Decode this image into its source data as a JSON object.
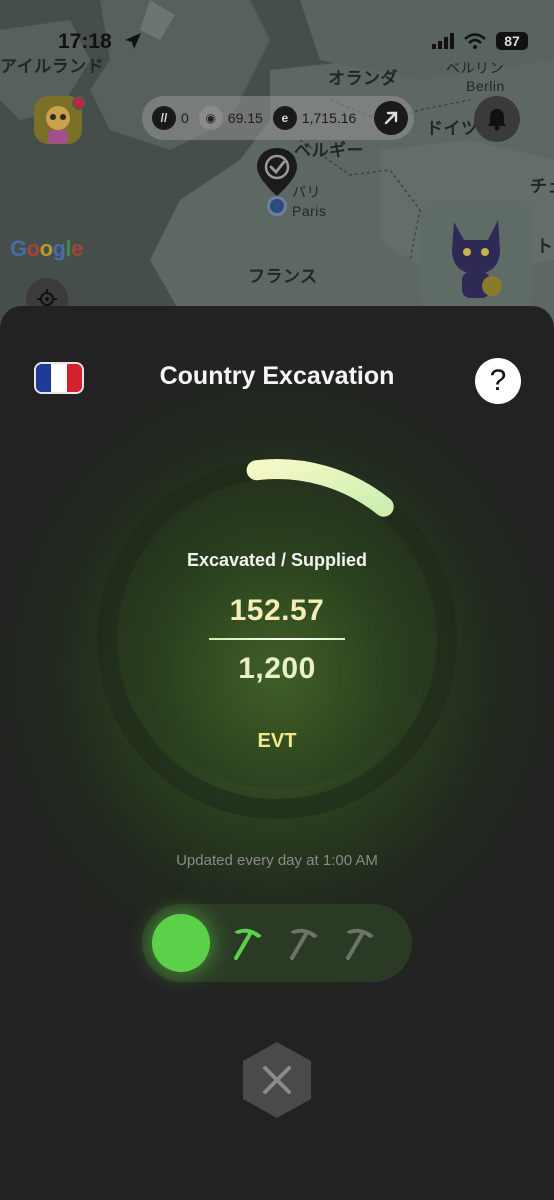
{
  "status_bar": {
    "time": "17:18",
    "battery": "87"
  },
  "map": {
    "labels": {
      "ireland": "アイルランド",
      "netherlands": "オランダ",
      "berlin_jp": "ベルリン",
      "berlin": "Berlin",
      "germany": "ドイツ",
      "belgium": "ベルギー",
      "paris_jp": "パリ",
      "paris": "Paris",
      "france": "フランス",
      "czech": "チェ",
      "edge": "ト"
    },
    "google": "Google"
  },
  "stats": {
    "items": [
      {
        "icon": "token-slash-icon",
        "value": "0"
      },
      {
        "icon": "cat-coin-icon",
        "value": "69.15"
      },
      {
        "icon": "e-coin-icon",
        "value": "1,715.16"
      }
    ]
  },
  "sheet": {
    "title": "Country Excavation",
    "help_label": "?",
    "flag": {
      "country": "France",
      "colors": [
        "#1e3c96",
        "#ffffff",
        "#d3222e"
      ]
    },
    "gauge": {
      "caption": "Excavated / Supplied",
      "excavated": "152.57",
      "supplied": "1,200",
      "unit": "EVT",
      "progress": 0.1271
    },
    "updated_text": "Updated every day at 1:00 AM",
    "pickaxes": {
      "total": 3,
      "active": 1
    }
  },
  "colors": {
    "accent_green": "#5bd14a",
    "sheet_bg": "#222222",
    "arc_start": "#f4f8c6",
    "arc_end": "#cdeeb0"
  }
}
